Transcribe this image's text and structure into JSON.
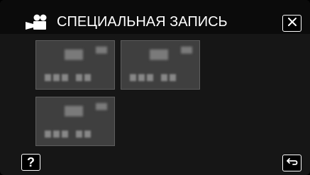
{
  "header": {
    "title": "СПЕЦИАЛЬНАЯ ЗАПИСЬ",
    "mode_icon": "movie-camera-icon",
    "close_icon": "close-x-icon"
  },
  "thumbnails": [
    {
      "icon": "blurred-mode-thumbnail"
    },
    {
      "icon": "blurred-mode-thumbnail"
    },
    {
      "icon": "blurred-mode-thumbnail"
    }
  ],
  "footer": {
    "help_label": "?",
    "back_icon": "return-arrow-icon"
  }
}
